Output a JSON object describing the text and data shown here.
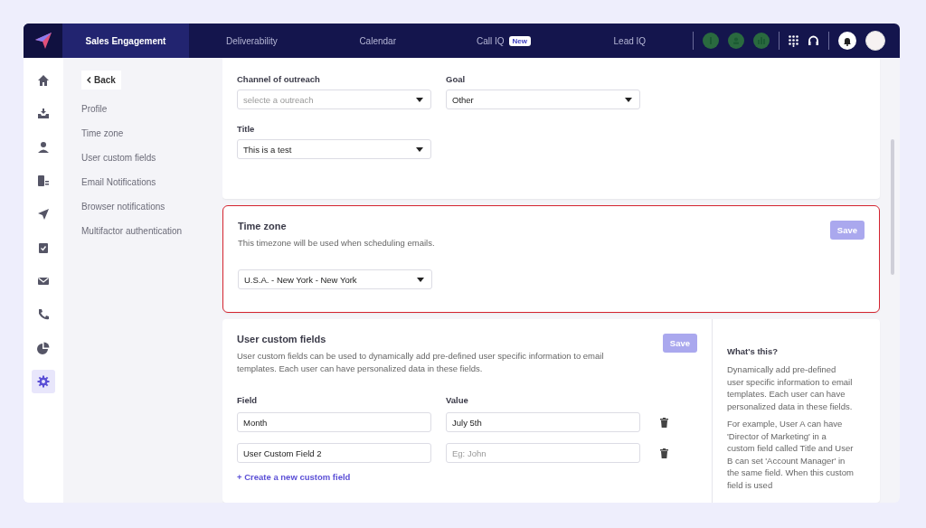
{
  "top_nav": {
    "tabs": [
      {
        "label": "Sales Engagement",
        "selected": true
      },
      {
        "label": "Deliverability",
        "selected": false
      },
      {
        "label": "Calendar",
        "selected": false
      },
      {
        "label": "Call IQ",
        "selected": false,
        "badge": "New"
      },
      {
        "label": "Lead IQ",
        "selected": false
      }
    ]
  },
  "icon_rail": [
    {
      "kind": "home",
      "selected": false
    },
    {
      "kind": "inbox",
      "selected": false
    },
    {
      "kind": "person",
      "selected": false
    },
    {
      "kind": "company",
      "selected": false
    },
    {
      "kind": "send",
      "selected": false
    },
    {
      "kind": "clipboard",
      "selected": false
    },
    {
      "kind": "mail",
      "selected": false
    },
    {
      "kind": "phone",
      "selected": false
    },
    {
      "kind": "pie",
      "selected": false
    },
    {
      "kind": "gear",
      "selected": true
    }
  ],
  "settings_menu": {
    "back": "Back",
    "items": [
      "Profile",
      "Time zone",
      "User custom fields",
      "Email Notifications",
      "Browser notifications",
      "Multifactor authentication"
    ]
  },
  "profile_card": {
    "fields": [
      {
        "label": "Channel of outreach",
        "placeholder": "selecte a outreach"
      },
      {
        "label": "Goal",
        "value": "Other"
      },
      {
        "label": "Title",
        "value": "This is a test"
      }
    ]
  },
  "timezone_card": {
    "title": "Time zone",
    "description": "This timezone will be used when scheduling emails.",
    "save": "Save",
    "value": "U.S.A. - New York - New York",
    "highlighted": true
  },
  "custom_fields_card": {
    "title": "User custom fields",
    "description": "User custom fields can be used to dynamically add pre-defined user specific information to email templates. Each user can have personalized data in these fields.",
    "save": "Save",
    "columns": [
      "Field",
      "Value"
    ],
    "rows": [
      {
        "field": "Month",
        "value": "July 5th"
      },
      {
        "field": "User Custom Field 2",
        "placeholder": "Eg: John"
      }
    ],
    "create_link": "+ Create a new custom field",
    "help": {
      "title": "What's this?",
      "paragraphs": [
        "Dynamically add pre-defined user specific information to email templates. Each user can have personalized data in these fields.",
        "For example, User A can have 'Director of Marketing' in a custom field called Title and User B can set 'Account Manager' in the same field. When this custom field is used"
      ]
    }
  }
}
